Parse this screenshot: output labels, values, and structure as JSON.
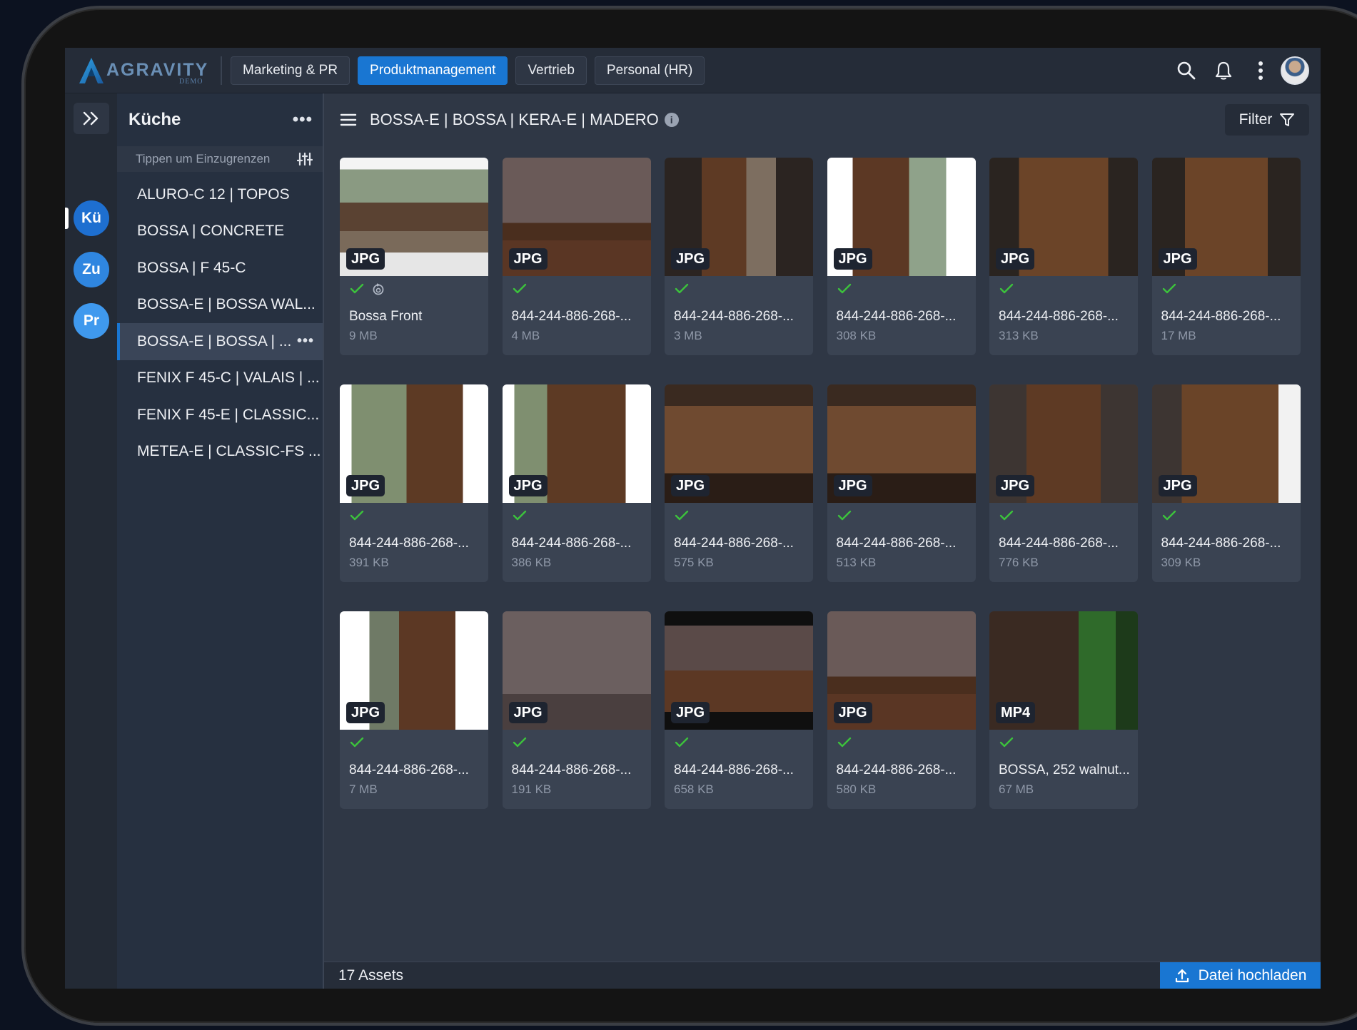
{
  "app": {
    "logo_text": "AGRAVITY",
    "logo_sub": "DEMO"
  },
  "topbar": {
    "tabs": [
      {
        "label": "Marketing & PR",
        "active": false
      },
      {
        "label": "Produktmanagement",
        "active": true
      },
      {
        "label": "Vertrieb",
        "active": false
      },
      {
        "label": "Personal (HR)",
        "active": false
      }
    ],
    "icons": [
      "search-icon",
      "bell-icon",
      "more-vertical-icon",
      "user-avatar"
    ]
  },
  "rail": {
    "avatars": [
      {
        "label": "Kü",
        "color": "#1e6fd0"
      },
      {
        "label": "Zu",
        "color": "#2f86e0"
      },
      {
        "label": "Pr",
        "color": "#3f99ee"
      }
    ]
  },
  "folders": {
    "title": "Küche",
    "filter_placeholder": "Tippen um Einzugrenzen",
    "items": [
      {
        "label": "ALURO-C 12 | TOPOS",
        "selected": false
      },
      {
        "label": "BOSSA | CONCRETE",
        "selected": false
      },
      {
        "label": "BOSSA | F 45-C",
        "selected": false
      },
      {
        "label": "BOSSA-E | BOSSA WAL...",
        "selected": false
      },
      {
        "label": "BOSSA-E | BOSSA | ...",
        "selected": true
      },
      {
        "label": "FENIX F 45-C | VALAIS | ...",
        "selected": false
      },
      {
        "label": "FENIX F 45-E | CLASSIC...",
        "selected": false
      },
      {
        "label": "METEA-E | CLASSIC-FS ...",
        "selected": false
      }
    ]
  },
  "main": {
    "breadcrumb": "BOSSA-E | BOSSA | KERA-E | MADERO",
    "filter_label": "Filter",
    "assets": [
      {
        "type": "JPG",
        "name": "Bossa Front",
        "size": "9 MB",
        "synced": true
      },
      {
        "type": "JPG",
        "name": "844-244-886-268-...",
        "size": "4 MB"
      },
      {
        "type": "JPG",
        "name": "844-244-886-268-...",
        "size": "3 MB"
      },
      {
        "type": "JPG",
        "name": "844-244-886-268-...",
        "size": "308 KB"
      },
      {
        "type": "JPG",
        "name": "844-244-886-268-...",
        "size": "313 KB"
      },
      {
        "type": "JPG",
        "name": "844-244-886-268-...",
        "size": "17 MB"
      },
      {
        "type": "JPG",
        "name": "844-244-886-268-...",
        "size": "391 KB"
      },
      {
        "type": "JPG",
        "name": "844-244-886-268-...",
        "size": "386 KB"
      },
      {
        "type": "JPG",
        "name": "844-244-886-268-...",
        "size": "575 KB"
      },
      {
        "type": "JPG",
        "name": "844-244-886-268-...",
        "size": "513 KB"
      },
      {
        "type": "JPG",
        "name": "844-244-886-268-...",
        "size": "776 KB"
      },
      {
        "type": "JPG",
        "name": "844-244-886-268-...",
        "size": "309 KB"
      },
      {
        "type": "JPG",
        "name": "844-244-886-268-...",
        "size": "7 MB"
      },
      {
        "type": "JPG",
        "name": "844-244-886-268-...",
        "size": "191 KB"
      },
      {
        "type": "JPG",
        "name": "844-244-886-268-...",
        "size": "658 KB"
      },
      {
        "type": "JPG",
        "name": "844-244-886-268-...",
        "size": "580 KB"
      },
      {
        "type": "MP4",
        "name": "BOSSA, 252 walnut...",
        "size": "67 MB"
      }
    ],
    "assets_count": "17 Assets",
    "upload_label": "Datei hochladen"
  },
  "colors": {
    "accent": "#1976d2",
    "check": "#3cc23c"
  }
}
